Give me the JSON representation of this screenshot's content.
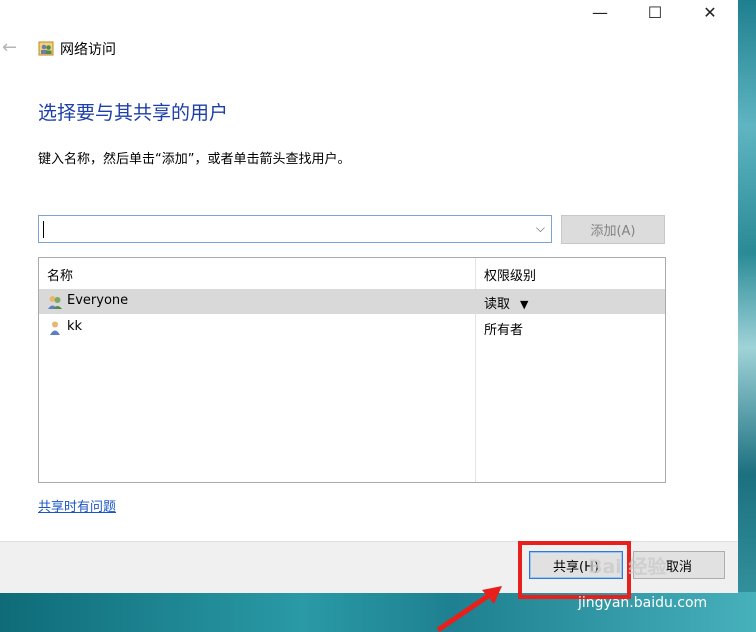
{
  "window": {
    "title": "网络访问",
    "minimize_glyph": "—",
    "maximize_glyph": "☐",
    "close_glyph": "✕",
    "back_glyph": "←"
  },
  "main": {
    "heading": "选择要与其共享的用户",
    "instruction": "键入名称，然后单击“添加”，或者单击箭头查找用户。",
    "name_input_value": "",
    "add_button_label": "添加(A)"
  },
  "list": {
    "col_name": "名称",
    "col_permission": "权限级别",
    "rows": [
      {
        "name": "Everyone",
        "permission": "读取",
        "has_dropdown": true,
        "selected": true,
        "icon": "group-icon"
      },
      {
        "name": "kk",
        "permission": "所有者",
        "has_dropdown": false,
        "selected": false,
        "icon": "user-icon"
      }
    ]
  },
  "link": "共享时有问题",
  "footer": {
    "share_label": "共享(H)",
    "cancel_label": "取消"
  },
  "watermark": {
    "logo": "Bai 经验",
    "url": "jingyan.baidu.com"
  },
  "colors": {
    "heading": "#1c3fa8",
    "link": "#1a56c4",
    "highlight": "#e8201c"
  }
}
